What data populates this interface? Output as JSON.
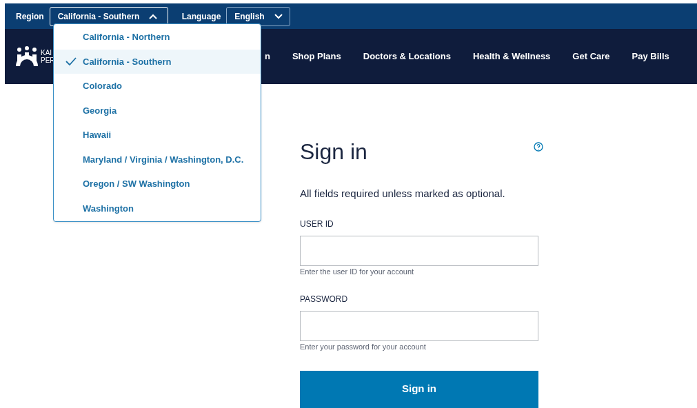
{
  "top_bar": {
    "region_label": "Region",
    "region_value": "California - Southern",
    "region_expanded": true,
    "language_label": "Language",
    "language_value": "English",
    "language_expanded": false
  },
  "region_menu": [
    {
      "label": "California - Northern",
      "selected": false
    },
    {
      "label": "California - Southern",
      "selected": true
    },
    {
      "label": "Colorado",
      "selected": false
    },
    {
      "label": "Georgia",
      "selected": false
    },
    {
      "label": "Hawaii",
      "selected": false
    },
    {
      "label": "Maryland / Virginia / Washington, D.C.",
      "selected": false
    },
    {
      "label": "Oregon / SW Washington",
      "selected": false
    },
    {
      "label": "Washington",
      "selected": false
    }
  ],
  "logo": {
    "line_1": "KAI",
    "line_2": "PER"
  },
  "nav": [
    "n",
    "Shop Plans",
    "Doctors & Locations",
    "Health & Wellness",
    "Get Care",
    "Pay Bills"
  ],
  "form": {
    "title": "Sign in",
    "note": "All fields required unless marked as optional.",
    "fields": [
      {
        "label": "USER ID",
        "hint": "Enter the user ID for your account"
      },
      {
        "label": "PASSWORD",
        "hint": "Enter your password for your account"
      }
    ],
    "submit": "Sign in"
  }
}
